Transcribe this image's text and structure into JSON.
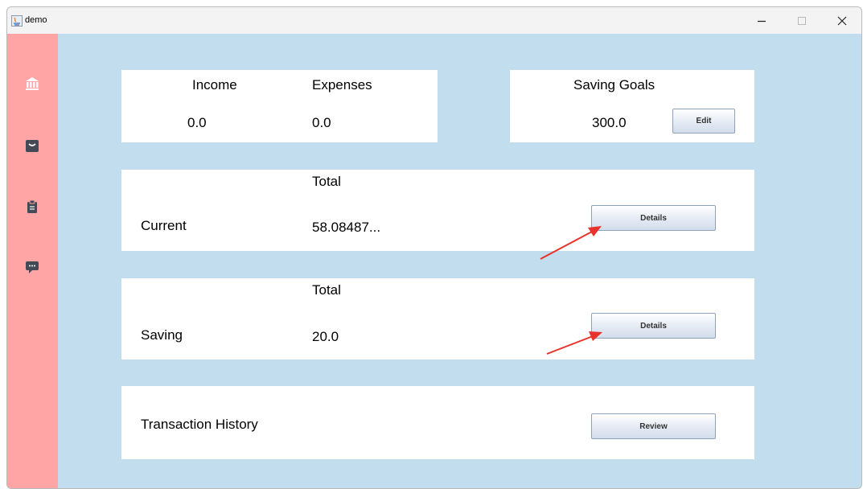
{
  "window": {
    "title": "demo",
    "minimize_icon": "minimize-icon",
    "maximize_icon": "maximize-icon",
    "close_icon": "close-icon"
  },
  "sidebar": {
    "items": [
      {
        "icon": "bank-icon"
      },
      {
        "icon": "bag-icon"
      },
      {
        "icon": "clipboard-icon"
      },
      {
        "icon": "chat-icon"
      }
    ],
    "color": "#ffa5a5"
  },
  "summary": {
    "income_label": "Income",
    "income_value": "0.0",
    "expenses_label": "Expenses",
    "expenses_value": "0.0"
  },
  "goals": {
    "label": "Saving Goals",
    "value": "300.0",
    "edit_label": "Edit"
  },
  "current": {
    "total_label": "Total",
    "label": "Current",
    "value": "58.08487...",
    "details_label": "Details"
  },
  "saving": {
    "total_label": "Total",
    "label": "Saving",
    "value": "20.0",
    "details_label": "Details"
  },
  "history": {
    "label": "Transaction History",
    "review_label": "Review"
  },
  "colors": {
    "background": "#c1ddee",
    "panel": "#ffffff",
    "annotation_arrow": "#e8322b"
  }
}
